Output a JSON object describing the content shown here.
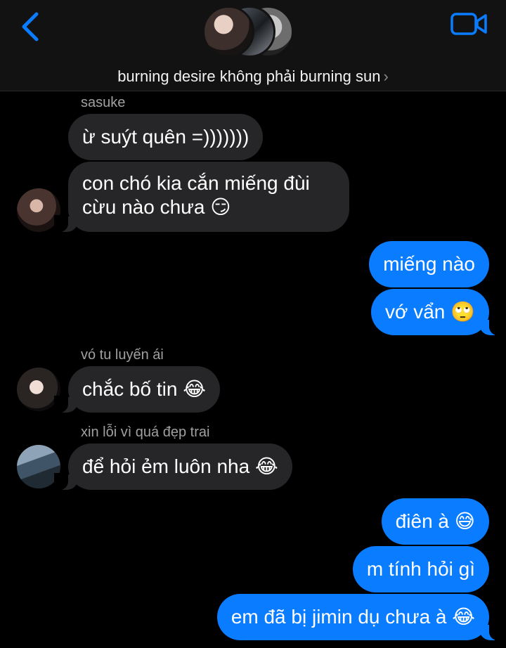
{
  "header": {
    "title": "burning desire không phải burning sun",
    "chevron": "›",
    "back_icon": "chevron-left-icon",
    "video_icon": "video-camera-icon",
    "accent": "#0a7cff"
  },
  "messages": [
    {
      "sender": "sasuke",
      "text": "ừ suýt quên =)))))))"
    },
    {
      "text": "con chó kia cắn miếng đùi cừu nào chưa",
      "emoji": "😏"
    },
    {
      "text": "miếng nào"
    },
    {
      "text": "vớ vẩn",
      "emoji": "🙄"
    },
    {
      "sender": "vó tu luyến ái",
      "text": "chắc bố tin",
      "emoji": "😂"
    },
    {
      "sender": "xin lỗi vì quá đẹp trai",
      "text": "để hỏi ẻm luôn nha",
      "emoji": "😂"
    },
    {
      "text": "điên à",
      "emoji": "😅"
    },
    {
      "text": "m tính hỏi gì"
    },
    {
      "text": "em đã bị jimin dụ chưa à",
      "emoji": "😂"
    }
  ]
}
